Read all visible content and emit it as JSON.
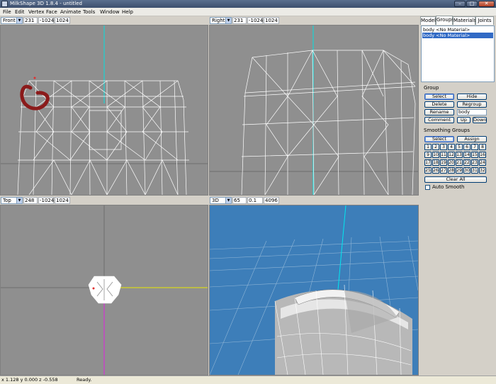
{
  "window": {
    "title": "MilkShape 3D 1.8.4 - untitled",
    "min": "–",
    "max": "□",
    "close": "✕"
  },
  "menu": [
    "File",
    "Edit",
    "Vertex",
    "Face",
    "Animate",
    "Tools",
    "Window",
    "Help"
  ],
  "viewports": {
    "front": {
      "view": "Front",
      "values": [
        "231",
        "-1024",
        "1024"
      ]
    },
    "right": {
      "view": "Right",
      "values": [
        "231",
        "-1024",
        "1024"
      ]
    },
    "top": {
      "view": "Top",
      "values": [
        "248",
        "-1024",
        "1024"
      ]
    },
    "persp": {
      "view": "3D",
      "values": [
        "65",
        "0.1",
        "4096"
      ]
    }
  },
  "colors": {
    "viewport_bg": "#8f8f8f",
    "persp_bg": "#3d7eb9",
    "axis_cyan": "#00e0e0",
    "axis_yellow": "#e8e800",
    "axis_magenta": "#e020e0",
    "selection": "#316ac5"
  },
  "panel": {
    "tabs": [
      "Model",
      "Groups",
      "Materials",
      "Joints"
    ],
    "active_tab": "Groups",
    "groups": [
      "body <No Material>",
      "body <No Material>"
    ],
    "group_section": "Group",
    "buttons": {
      "select": "Select",
      "hide": "Hide",
      "delete": "Delete",
      "regroup": "Regroup",
      "rename": "Rename",
      "comment": "Comment",
      "up": "Up",
      "down": "Down"
    },
    "name_value": "body",
    "smoothing_section": "Smoothing Groups",
    "sg_select": "Select",
    "sg_assign": "Assign",
    "sg_numbers": [
      "1",
      "2",
      "3",
      "4",
      "5",
      "6",
      "7",
      "8",
      "9",
      "10",
      "11",
      "12",
      "13",
      "14",
      "15",
      "16",
      "17",
      "18",
      "19",
      "20",
      "21",
      "22",
      "23",
      "24",
      "25",
      "26",
      "27",
      "28",
      "29",
      "30",
      "31",
      "32"
    ],
    "clear_all": "Clear All",
    "auto_smooth": "Auto Smooth"
  },
  "status": {
    "coords": "x 1.128 y 0.000 z -0.558",
    "message": "Ready."
  }
}
